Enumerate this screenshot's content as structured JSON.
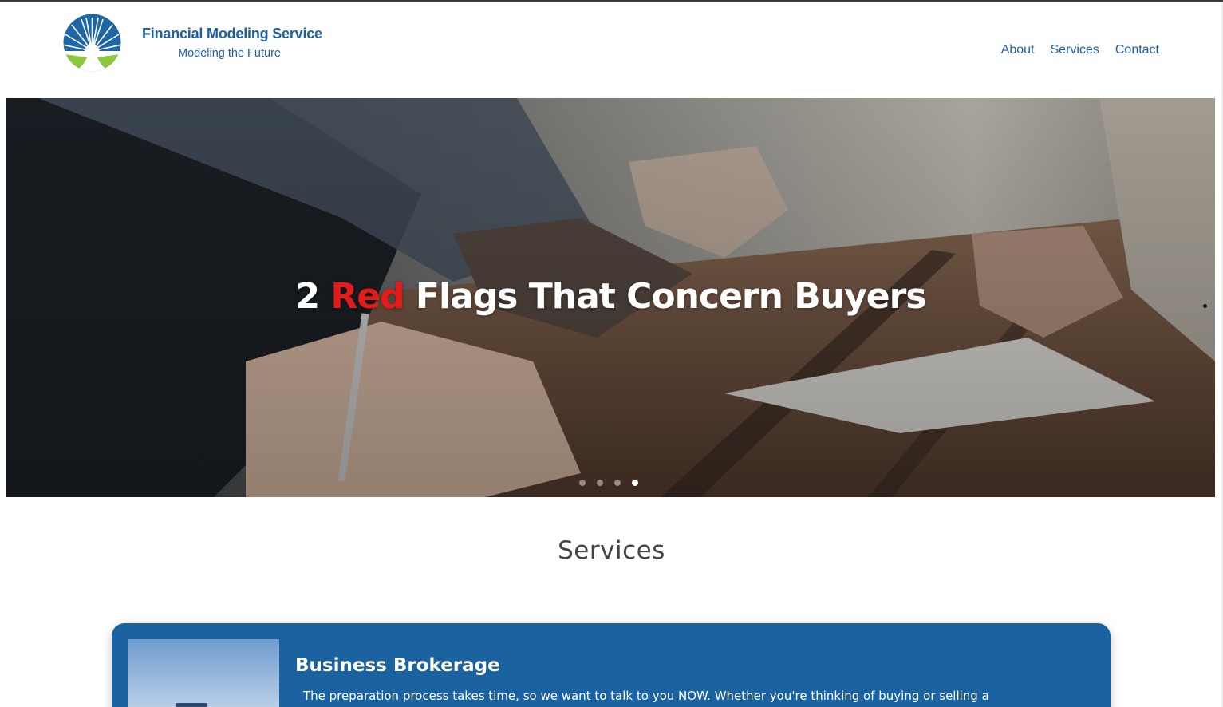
{
  "brand": {
    "name": "Financial Modeling Service",
    "tagline": "Modeling the Future",
    "colors": {
      "primary": "#1f5fa1",
      "accent_green": "#8dc63f",
      "card_blue": "#1b62a1",
      "highlight_red": "#e31b1b"
    }
  },
  "nav": {
    "items": [
      {
        "label": "About"
      },
      {
        "label": "Services"
      },
      {
        "label": "Contact"
      }
    ]
  },
  "hero": {
    "title_prefix": "2 ",
    "title_accent": "Red",
    "title_suffix": " Flags That Concern Buyers",
    "slides_total": 4,
    "active_slide": 4
  },
  "services": {
    "heading": "Services",
    "cards": [
      {
        "title": "Business Brokerage",
        "text": "The preparation process takes time, so we want to talk to you NOW. Whether you're thinking of buying or selling a"
      }
    ]
  },
  "icons": [
    "sunburst-logo-icon"
  ]
}
